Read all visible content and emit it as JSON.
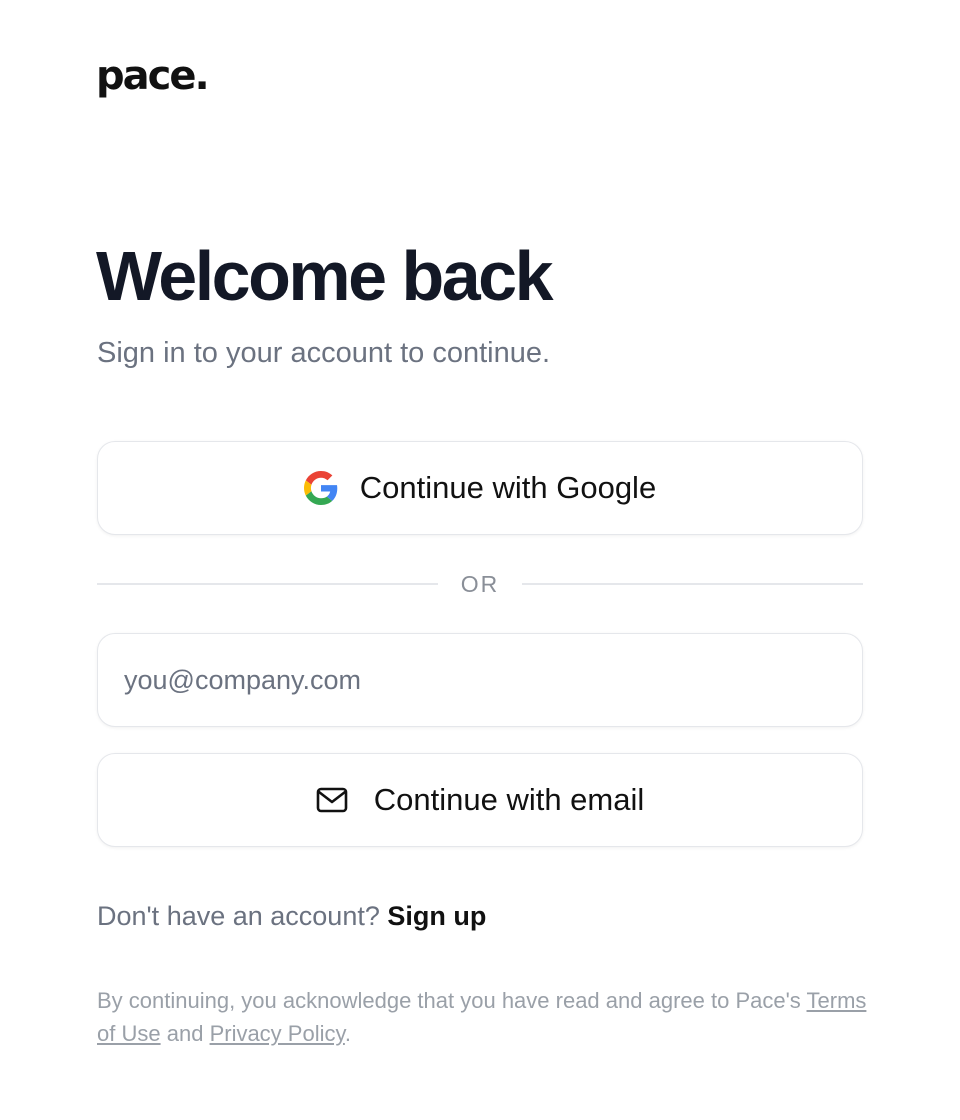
{
  "brand": {
    "name": "pace",
    "dot": "."
  },
  "heading": {
    "title": "Welcome back",
    "subtitle": "Sign in to your account to continue."
  },
  "google_button": {
    "label": "Continue with Google",
    "icon": "google-logo-icon"
  },
  "divider": {
    "label": "OR"
  },
  "email_field": {
    "placeholder": "you@company.com",
    "value": ""
  },
  "email_button": {
    "label": "Continue with email",
    "icon": "envelope-icon"
  },
  "signup": {
    "prompt": "Don't have an account?",
    "link": "Sign up"
  },
  "legal": {
    "prefix": "By continuing, you acknowledge that you have read and agree to Pace's",
    "terms_link": "Terms of Use",
    "conjunction": "and",
    "privacy_link": "Privacy Policy",
    "suffix": "."
  },
  "colors": {
    "title": "#131826",
    "muted_text": "#6b7280",
    "legal_text": "#9aa0a8",
    "border": "#e5e7eb",
    "google_blue": "#4285F4",
    "google_green": "#34A853",
    "google_yellow": "#FBBC05",
    "google_red": "#EA4335"
  }
}
